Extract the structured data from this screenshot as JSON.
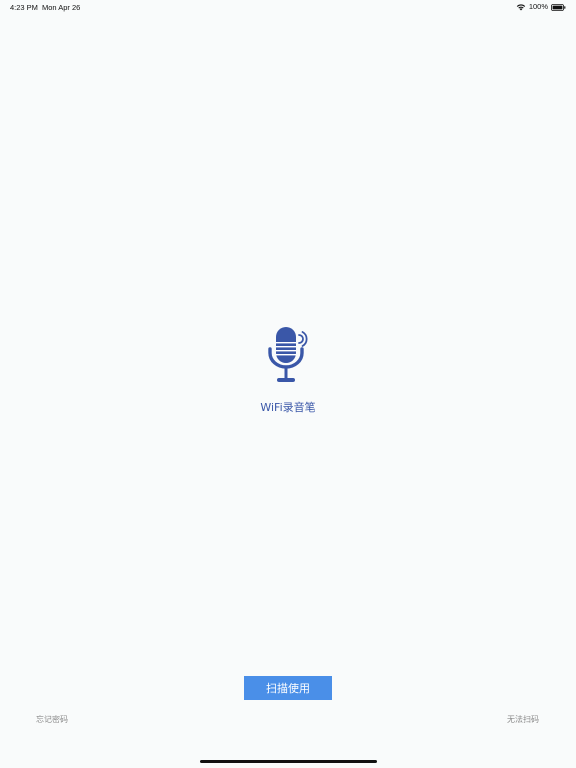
{
  "status_bar": {
    "time": "4:23 PM",
    "date": "Mon Apr 26",
    "battery": "100%"
  },
  "app": {
    "name": "WiFi录音笔",
    "logo_icon": "microphone-icon",
    "accent_color": "#3a57a8"
  },
  "actions": {
    "scan_label": "扫描使用",
    "scan_color": "#4a8fe8",
    "forgot_password": "忘记密码",
    "cannot_scan": "无法扫码"
  }
}
